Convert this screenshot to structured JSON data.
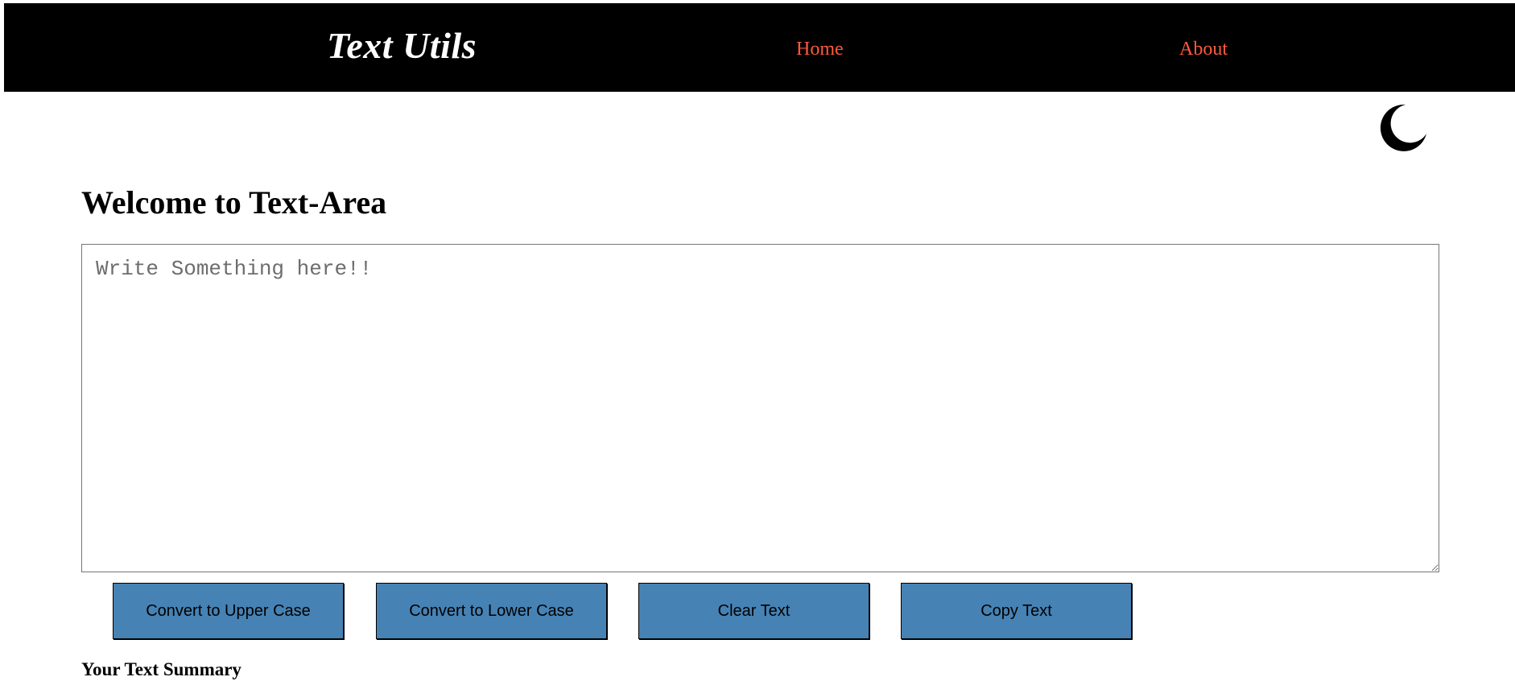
{
  "navbar": {
    "brand": "Text Utils",
    "links": [
      {
        "label": "Home"
      },
      {
        "label": "About"
      }
    ],
    "link_color": "#ff5a3c",
    "background": "#000000"
  },
  "theme_toggle": {
    "icon": "moon-icon"
  },
  "main": {
    "title": "Welcome to Text-Area",
    "textarea": {
      "value": "",
      "placeholder": "Write Something here!!"
    },
    "buttons": [
      {
        "label": "Convert to Upper Case"
      },
      {
        "label": "Convert to Lower Case"
      },
      {
        "label": "Clear Text"
      },
      {
        "label": "Copy Text"
      }
    ],
    "button_color": "#4682b4",
    "summary_title": "Your Text Summary"
  }
}
